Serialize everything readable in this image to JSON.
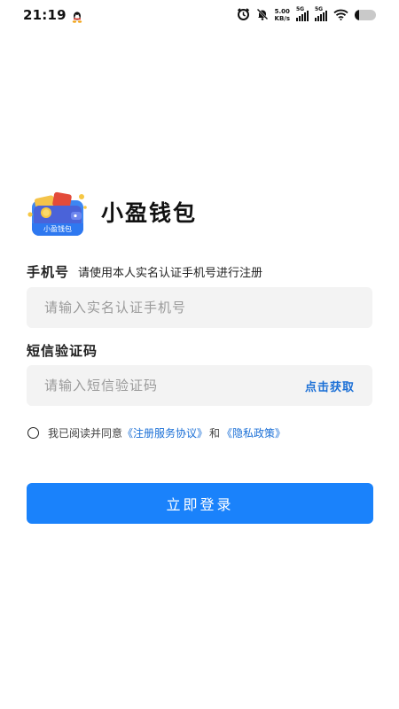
{
  "status_bar": {
    "time": "21:19",
    "net_speed_value": "5.00",
    "net_speed_unit": "KB/s",
    "signal_1_label": "5G",
    "signal_2_label": "5G",
    "battery_level": 0.2,
    "icons": [
      "qq-icon",
      "alarm-icon",
      "mute-icon",
      "signal-icon",
      "wifi-icon",
      "battery-icon"
    ]
  },
  "brand": {
    "logo_caption": "小盈钱包",
    "app_name": "小盈钱包"
  },
  "phone": {
    "label": "手机号",
    "hint": "请使用本人实名认证手机号进行注册",
    "placeholder": "请输入实名认证手机号",
    "value": ""
  },
  "sms": {
    "label": "短信验证码",
    "placeholder": "请输入短信验证码",
    "value": "",
    "get_code_label": "点击获取"
  },
  "agreement": {
    "checked": false,
    "prefix": "我已阅读并同意",
    "terms_link": "《注册服务协议》",
    "joiner": "和",
    "privacy_link": "《隐私政策》"
  },
  "login": {
    "button_label": "立即登录"
  },
  "colors": {
    "accent": "#1a82fb",
    "link": "#1a6fd6",
    "input_bg": "#f3f3f3"
  }
}
